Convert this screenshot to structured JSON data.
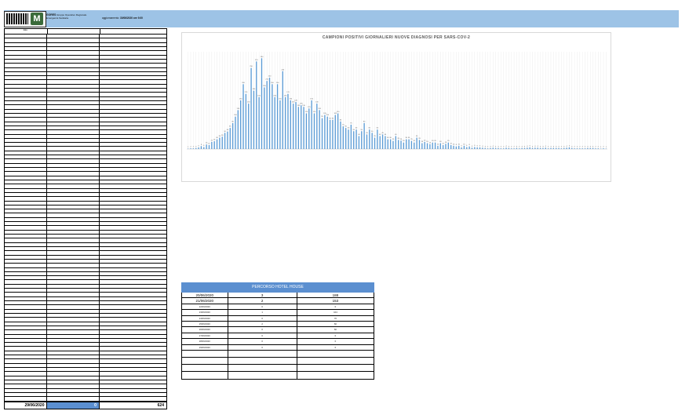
{
  "header": {
    "org_name": "GORES",
    "org_desc": "Gruppo Operativo Regionale",
    "org_desc2": "Emergenza Sanitaria",
    "update_label": "aggiornamento:",
    "update_value": "30/06/2020 ore 9.00"
  },
  "left_table": {
    "headers": [
      "data",
      "",
      ""
    ],
    "rows": [
      {
        "date": "",
        "a": "",
        "b": ""
      }
    ],
    "total": {
      "date": "29/06/2020",
      "a": "0",
      "b": "624"
    }
  },
  "chart_data": {
    "type": "bar",
    "title": "CAMPIONI POSITIVI GIORNALIERI NUOVE DIAGNOSI PER SARS-COV-2",
    "xlabel": "",
    "ylabel": "",
    "grid": true,
    "colors": {
      "bar": "#5b9bd5"
    },
    "values": [
      1,
      2,
      2,
      3,
      5,
      9,
      6,
      14,
      12,
      22,
      24,
      30,
      35,
      38,
      50,
      54,
      65,
      80,
      100,
      120,
      150,
      200,
      170,
      140,
      250,
      180,
      270,
      160,
      280,
      190,
      210,
      220,
      200,
      160,
      200,
      150,
      240,
      160,
      170,
      150,
      140,
      145,
      130,
      135,
      130,
      110,
      125,
      150,
      110,
      140,
      120,
      95,
      105,
      100,
      90,
      90,
      105,
      110,
      85,
      70,
      65,
      60,
      75,
      55,
      60,
      40,
      55,
      80,
      45,
      60,
      50,
      35,
      60,
      40,
      45,
      40,
      30,
      30,
      25,
      40,
      28,
      26,
      20,
      30,
      30,
      25,
      20,
      35,
      28,
      18,
      22,
      18,
      15,
      20,
      20,
      10,
      18,
      12,
      16,
      20,
      12,
      10,
      8,
      10,
      5,
      10,
      6,
      8,
      4,
      6,
      5,
      5,
      4,
      3,
      2,
      3,
      4,
      3,
      3,
      2,
      2,
      4,
      3,
      2,
      2,
      3,
      2,
      3,
      3,
      4,
      5,
      3,
      4,
      4,
      3,
      3,
      4,
      2,
      3,
      3,
      3,
      3,
      2,
      3,
      4,
      5,
      3,
      2,
      2,
      2,
      2,
      2,
      3,
      3,
      3,
      2,
      2,
      1,
      2,
      1
    ]
  },
  "right_table": {
    "title": "PERCORSO HOTEL HOUSE",
    "rows": [
      [
        "20/06/2020",
        "3",
        "188"
      ],
      [
        "21/06/2020",
        "2",
        "153"
      ],
      [
        "22/06/2020",
        "0",
        "0"
      ],
      [
        "23/06/2020",
        "1",
        "104"
      ],
      [
        "24/06/2020",
        "0",
        "70"
      ],
      [
        "25/06/2020",
        "2",
        "60"
      ],
      [
        "26/06/2020",
        "0",
        "60"
      ],
      [
        "27/06/2020",
        "0",
        "0"
      ],
      [
        "28/06/2020",
        "0",
        "0"
      ],
      [
        "29/06/2020",
        "0",
        "0"
      ]
    ],
    "empty_rows": 4
  }
}
